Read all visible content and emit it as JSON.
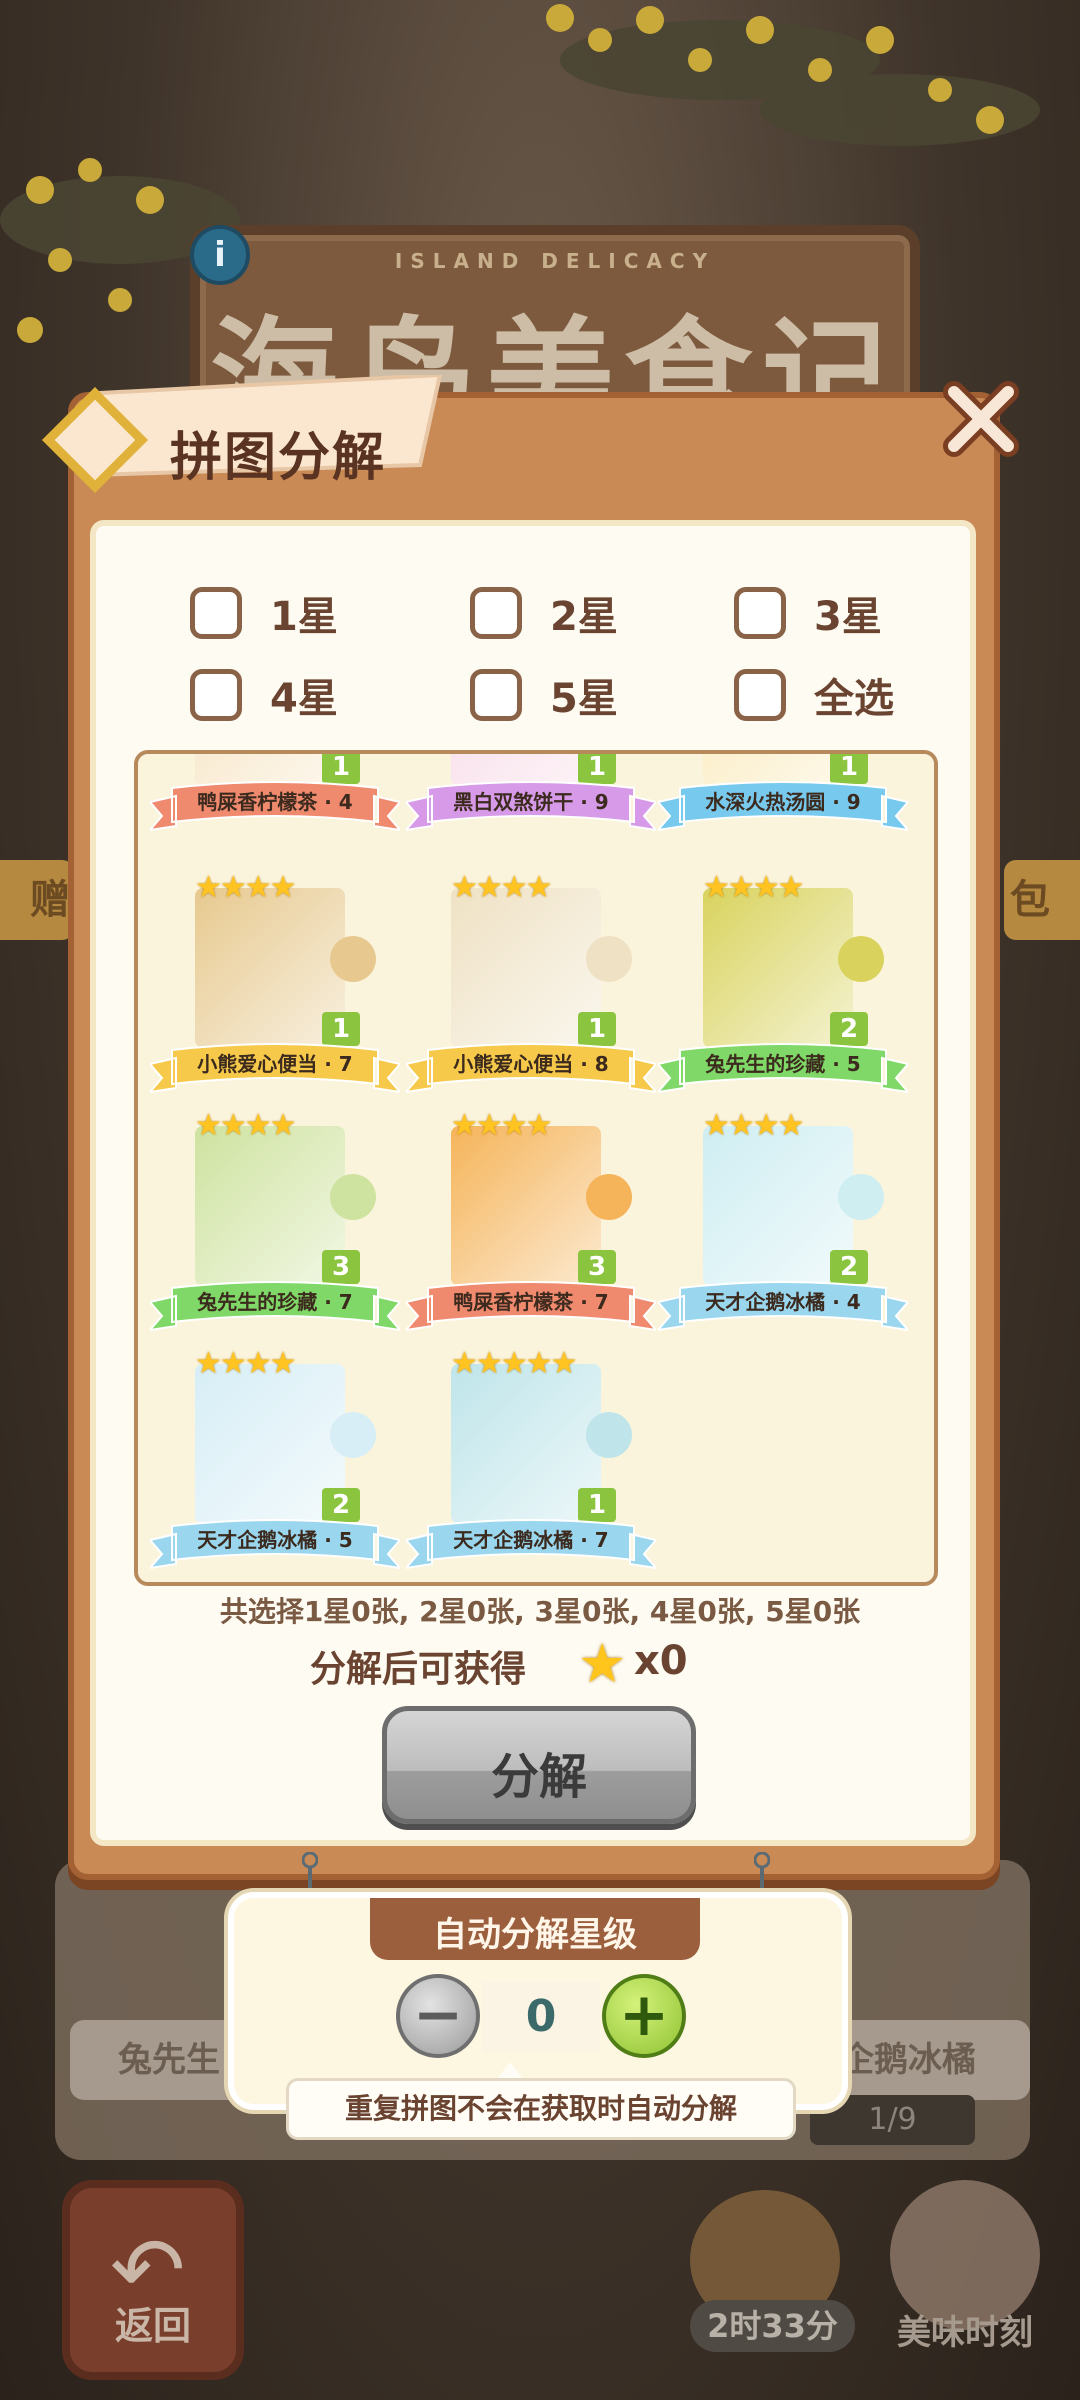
{
  "background": {
    "title_sub": "ISLAND DELICACY",
    "title_main": "海岛美食记",
    "info_icon": "i",
    "left_tab": "赠",
    "right_tab": "包",
    "card_label_left": "兔先生",
    "card_label_right": "企鹅冰橘",
    "page_indicator": "1/9",
    "back_label": "返回",
    "timer": "2时33分",
    "moment_label": "美味时刻"
  },
  "dialog": {
    "title": "拼图分解",
    "close_icon": "close-x-icon",
    "filters": [
      {
        "label": "1星",
        "checked": false
      },
      {
        "label": "2星",
        "checked": false
      },
      {
        "label": "3星",
        "checked": false
      },
      {
        "label": "4星",
        "checked": false
      },
      {
        "label": "5星",
        "checked": false
      },
      {
        "label": "全选",
        "checked": false
      }
    ],
    "cards": [
      {
        "name": "鸭屎香柠檬茶 · 4",
        "count": "1",
        "stars": "",
        "ribbon": "#f08a6f",
        "art": "#f6e3c0"
      },
      {
        "name": "黑白双煞饼干 · 9",
        "count": "1",
        "stars": "",
        "ribbon": "#d79ae8",
        "art": "#f7d9e6"
      },
      {
        "name": "水深火热汤圆 · 9",
        "count": "1",
        "stars": "",
        "ribbon": "#78c9ee",
        "art": "#fae9b8"
      },
      {
        "name": "小熊爱心便当 · 7",
        "count": "1",
        "stars": "★★★★",
        "ribbon": "#f6c94a",
        "art": "#e7c98f"
      },
      {
        "name": "小熊爱心便当 · 8",
        "count": "1",
        "stars": "★★★★",
        "ribbon": "#f6c94a",
        "art": "#efe2c4"
      },
      {
        "name": "兔先生的珍藏 · 5",
        "count": "2",
        "stars": "★★★★",
        "ribbon": "#7fd867",
        "art": "#d9d35e"
      },
      {
        "name": "兔先生的珍藏 · 7",
        "count": "3",
        "stars": "★★★★",
        "ribbon": "#7fd867",
        "art": "#cfe3a0"
      },
      {
        "name": "鸭屎香柠檬茶 · 7",
        "count": "3",
        "stars": "★★★★",
        "ribbon": "#f08a6f",
        "art": "#f5b45a"
      },
      {
        "name": "天才企鹅冰橘 · 4",
        "count": "2",
        "stars": "★★★★",
        "ribbon": "#9ad7ef",
        "art": "#cfeef2"
      },
      {
        "name": "天才企鹅冰橘 · 5",
        "count": "2",
        "stars": "★★★★",
        "ribbon": "#9ad7ef",
        "art": "#d7eef6"
      },
      {
        "name": "天才企鹅冰橘 · 7",
        "count": "1",
        "stars": "★★★★★",
        "ribbon": "#9ad7ef",
        "art": "#bfe5ea"
      }
    ],
    "summary": "共选择1星0张, 2星0张, 3星0张, 4星0张, 5星0张",
    "reward_label": "分解后可获得",
    "reward_icon": "star-icon",
    "reward_count": "x0",
    "decompose_label": "分解"
  },
  "auto_panel": {
    "header": "自动分解星级",
    "minus": "−",
    "plus": "+",
    "level": "0",
    "tip": "重复拼图不会在获取时自动分解"
  },
  "colors": {
    "dialog_frame": "#c98a55",
    "plus_button": "#8fc233",
    "star": "#ffc422"
  }
}
